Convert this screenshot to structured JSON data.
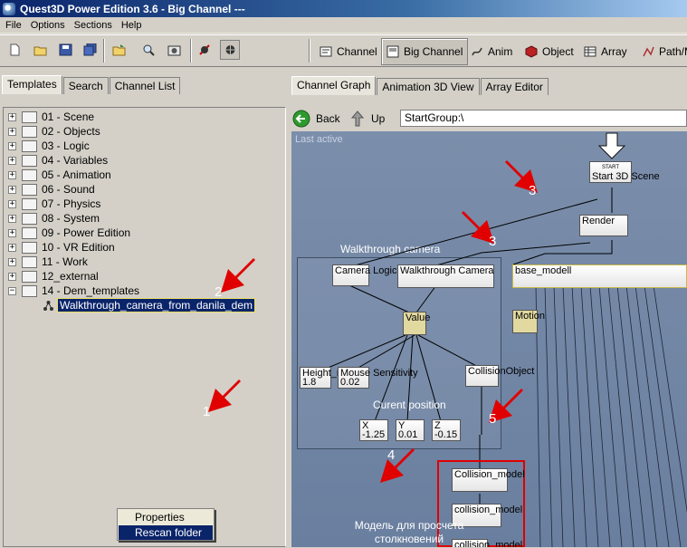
{
  "window": {
    "title": "Quest3D Power Edition 3.6     -  Big Channel  ---"
  },
  "menu": [
    "File",
    "Options",
    "Sections",
    "Help"
  ],
  "toolbar": {
    "icons": [
      "new-file-icon",
      "open-folder-icon",
      "save-icon",
      "save-all-icon",
      "open-project-icon",
      "zoom-icon",
      "screenshot-icon",
      "cut-node-icon",
      "pan-icon"
    ],
    "views": [
      {
        "label": "Channel",
        "icon": "channel-icon"
      },
      {
        "label": "Big Channel",
        "icon": "big-channel-icon",
        "pressed": true
      },
      {
        "label": "Anim",
        "icon": "anim-icon"
      },
      {
        "label": "Object",
        "icon": "object-icon"
      },
      {
        "label": "Array",
        "icon": "array-icon"
      },
      {
        "label": "Path/M",
        "icon": "path-icon"
      }
    ]
  },
  "left_tabs": [
    "Templates",
    "Search",
    "Channel List"
  ],
  "tree": {
    "items": [
      "01 - Scene",
      "02 - Objects",
      "03 - Logic",
      "04 - Variables",
      "05 - Animation",
      "06 - Sound",
      "07 - Physics",
      "08 - System",
      "09 - Power Edition",
      "10 - VR Edition",
      "11 - Work",
      "12_external",
      "14 - Dem_templates"
    ],
    "selected_child": "Walkthrough_camera_from_danila_dem"
  },
  "context_menu": {
    "items": [
      "Properties",
      "Rescan folder"
    ],
    "highlighted": "Rescan folder"
  },
  "right_tabs": [
    "Channel Graph",
    "Animation 3D View",
    "Array Editor"
  ],
  "nav": {
    "back": "Back",
    "up": "Up",
    "path": "StartGroup:\\"
  },
  "graph": {
    "last_active": "Last active",
    "group_title": "Walkthrough camera",
    "nodes": {
      "start": "Start 3D Scene",
      "start_tag": "START",
      "render": "Render",
      "base": "base_modell",
      "camera_logic": "Camera Logic",
      "walk_cam": "Walkthrough Camera",
      "value": "Value",
      "motion": "Motion",
      "height": "Height_m",
      "height_val": "1.8",
      "mouse": "Mouse Sensitivity",
      "mouse_val": "0.02",
      "collision_obj": "CollisionObject",
      "cur_pos": "Curent position",
      "x": "X",
      "x_val": "-1.25",
      "y": "Y",
      "y_val": "0.01",
      "z": "Z",
      "z_val": "-0.15",
      "coll1": "Collision_model",
      "coll2": "collision_model",
      "coll3": "collision_model"
    },
    "caption": [
      "Модель для просчета",
      "столкновений"
    ]
  },
  "annotations": [
    "1",
    "2",
    "3",
    "3",
    "4",
    "5"
  ],
  "colors": {
    "selection": "#0a246a",
    "graph_bg": "#6f839f",
    "arrow": "#e00000",
    "title_bar": "#0a246a"
  }
}
